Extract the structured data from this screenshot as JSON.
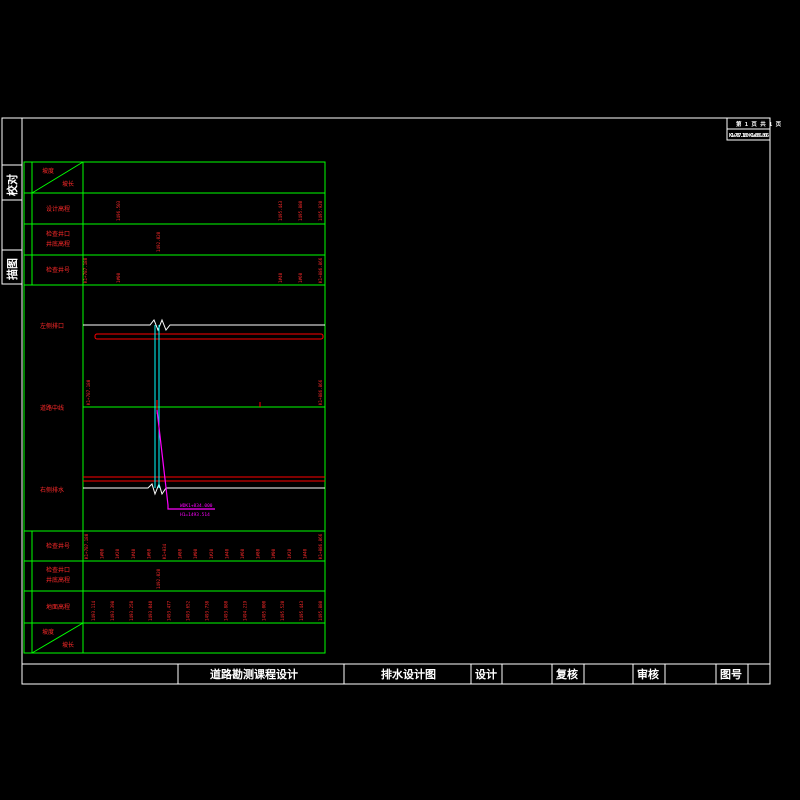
{
  "sheet": {
    "page_info": "第 1 页    共 1 页",
    "station_range": "K1+787.180~K1+886.866"
  },
  "side_labels": [
    "校对",
    "描图"
  ],
  "top_table": {
    "header_top": "坡度",
    "header_bottom": "坡长",
    "rows": [
      "设计高程",
      "检查井口",
      "井底高程",
      "检查井号"
    ]
  },
  "plan_labels": [
    "左侧排口",
    "道路中线",
    "右侧排水"
  ],
  "bottom_table": {
    "rows": [
      "检查井号",
      "检查井口",
      "井底高程",
      "地面高程"
    ],
    "header_top": "坡度",
    "header_bottom": "坡长"
  },
  "title_block": {
    "project": "道路勘测课程设计",
    "drawing": "排水设计图",
    "design": "设计",
    "review": "复核",
    "audit": "审核",
    "drawing_no": "图号"
  },
  "small_values": {
    "top_row1": [
      "1496.503",
      "1495.443",
      "1495.880",
      "1495.920"
    ],
    "top_row2": [
      "1492.020"
    ],
    "top_row3": [
      "K1+787.180",
      "1#00",
      "1#40",
      "1#60",
      "K1+886.866"
    ],
    "plan_left": "K1+787.180",
    "plan_right": "K1+886.866",
    "bot_row1": [
      "K1+787.180",
      "1#00",
      "1#20",
      "1#40",
      "1#60",
      "K1+834",
      "1#80",
      "1#00",
      "1#20",
      "1#40",
      "1#60",
      "1#80",
      "1#00",
      "1#20",
      "1#40",
      "K1+886.866"
    ],
    "bot_row2": [
      "1492.020"
    ],
    "bot_row3": [
      "1493.114",
      "1493.398",
      "1493.258",
      "1493.040",
      "1493.477",
      "1493.652",
      "1493.738",
      "1493.880",
      "1494.219",
      "1495.000",
      "1495.520",
      "1495.443",
      "1495.880"
    ],
    "callout1": "WDK1+834.000",
    "callout2": "H1=1493.514"
  }
}
